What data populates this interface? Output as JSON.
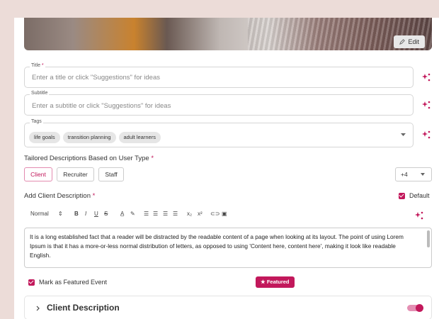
{
  "hero": {
    "edit_label": "Edit"
  },
  "title_field": {
    "label": "Title",
    "required": "*",
    "placeholder": "Enter a title or click \"Suggestions\" for ideas"
  },
  "subtitle_field": {
    "label": "Subtitle",
    "placeholder": "Enter a subtitle or click \"Suggestions\" for ideas"
  },
  "tags_field": {
    "label": "Tags",
    "chips": [
      "life goals",
      "transition planning",
      "adult learners"
    ]
  },
  "descriptions": {
    "heading": "Tailored Descriptions Based on User Type",
    "required": "*",
    "tabs": [
      "Client",
      "Recruiter",
      "Staff"
    ],
    "active_tab": "Client",
    "more_select": "+4"
  },
  "client_description": {
    "label": "Add Client Description",
    "required": "*",
    "default_label": "Default",
    "default_checked": true,
    "body": "It is a long established fact that a reader will be distracted by the readable content of a page when looking at its layout. The point of using Lorem Ipsum is that it has a more-or-less normal distribution of letters, as opposed to using 'Content here, content here', making it look like readable English."
  },
  "toolbar": {
    "format_select": "Normal",
    "bold": "B",
    "italic": "I",
    "underline": "U",
    "strike": "S",
    "subscript": "x₂",
    "superscript": "x²"
  },
  "featured": {
    "checkbox_label": "Mark as Featured Event",
    "checked": true,
    "badge_label": "Featured"
  },
  "accordion": {
    "title": "Client Description",
    "toggle_on": true
  },
  "colors": {
    "accent": "#c2185b"
  }
}
